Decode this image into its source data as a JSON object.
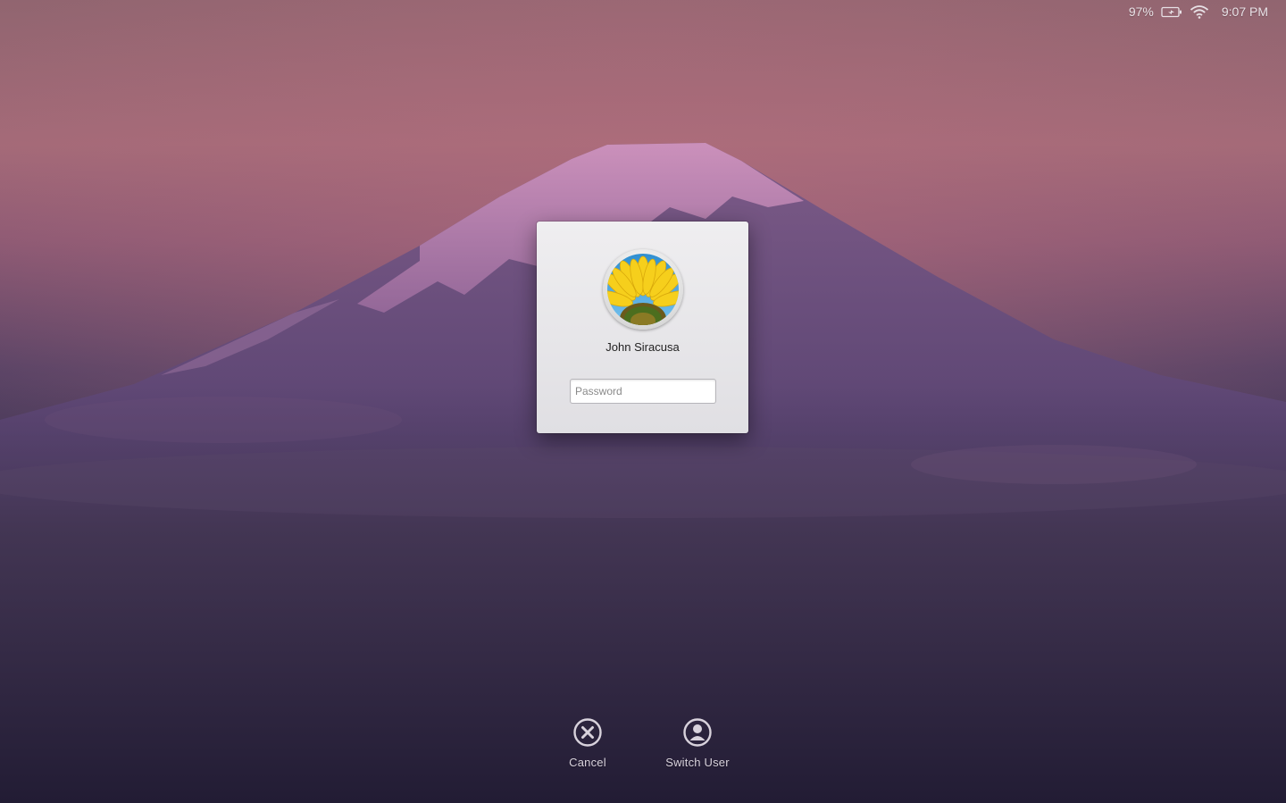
{
  "status_bar": {
    "battery_percent": "97%",
    "battery_icon": "battery-charging-icon",
    "wifi_icon": "wifi-icon",
    "time": "9:07 PM"
  },
  "login": {
    "avatar_icon": "sunflower-avatar-icon",
    "user_name": "John Siracusa",
    "password_placeholder": "Password",
    "password_value": ""
  },
  "actions": {
    "cancel": {
      "label": "Cancel",
      "icon": "cancel-circle-icon"
    },
    "switch_user": {
      "label": "Switch User",
      "icon": "user-circle-icon"
    }
  },
  "colors": {
    "sky_top": "#916570",
    "sky_glow": "#a46a78",
    "mountain": "#5b4570",
    "snow": "#c586b8",
    "bottom": "#231d35",
    "panel": "#e6e5e9",
    "text_light": "#d8d2dc"
  }
}
